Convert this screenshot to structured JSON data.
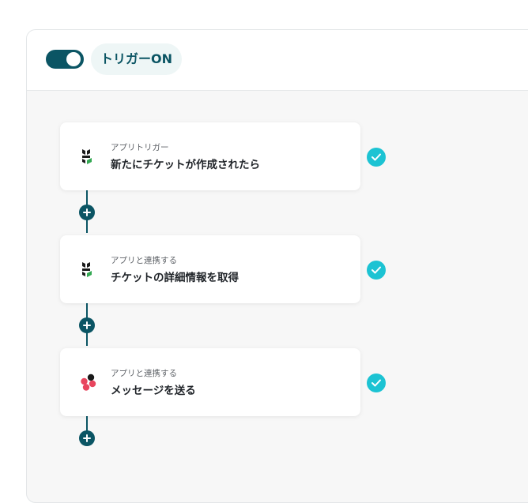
{
  "header": {
    "toggle_state": "on",
    "trigger_label": "トリガーON"
  },
  "steps": [
    {
      "subtitle": "アプリトリガー",
      "title": "新たにチケットが作成されたら",
      "icon": "helpdesk-app-icon",
      "status": "completed"
    },
    {
      "subtitle": "アプリと連携する",
      "title": "チケットの詳細情報を取得",
      "icon": "helpdesk-app-icon",
      "status": "completed"
    },
    {
      "subtitle": "アプリと連携する",
      "title": "メッセージを送る",
      "icon": "chat-app-icon",
      "status": "completed"
    }
  ],
  "colors": {
    "primary": "#0b5564",
    "check": "#1cc3d3",
    "pill_bg": "#eef6f6",
    "canvas_bg": "#f7f7f7"
  }
}
